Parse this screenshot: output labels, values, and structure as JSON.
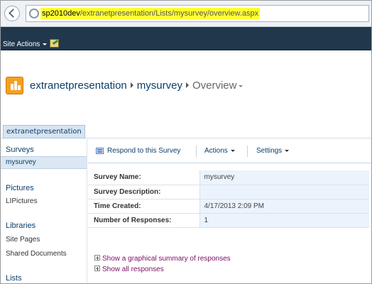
{
  "browser": {
    "url_host": "sp2010dev",
    "url_path": "/extranetpresentation/Lists/mysurvey/overview.aspx"
  },
  "ribbon": {
    "site_actions_label": "Site Actions"
  },
  "title": {
    "site_name": "extranetpresentation",
    "list_name": "mysurvey",
    "view_name": "Overview"
  },
  "top_nav": {
    "active_link": "extranetpresentation"
  },
  "left_nav": {
    "surveys_heading": "Surveys",
    "surveys_selected": "mysurvey",
    "pictures_heading": "Pictures",
    "pictures_item": "LIPictures",
    "libraries_heading": "Libraries",
    "libraries_items": [
      "Site Pages",
      "Shared Documents"
    ],
    "lists_heading": "Lists"
  },
  "toolbar": {
    "respond_label": "Respond to this Survey",
    "actions_label": "Actions",
    "settings_label": "Settings"
  },
  "survey": {
    "rows": [
      {
        "label": "Survey Name:",
        "value": "mysurvey"
      },
      {
        "label": "Survey Description:",
        "value": ""
      },
      {
        "label": "Time Created:",
        "value": "4/17/2013 2:09 PM"
      },
      {
        "label": "Number of Responses:",
        "value": "1"
      }
    ]
  },
  "links": {
    "graphical_summary": "Show a graphical summary of responses",
    "all_responses": "Show all responses"
  },
  "colors": {
    "ribbon": "#21374c",
    "link": "#0b3e6a",
    "visited_link": "#7a0e63",
    "url_highlight": "#ffff33"
  }
}
